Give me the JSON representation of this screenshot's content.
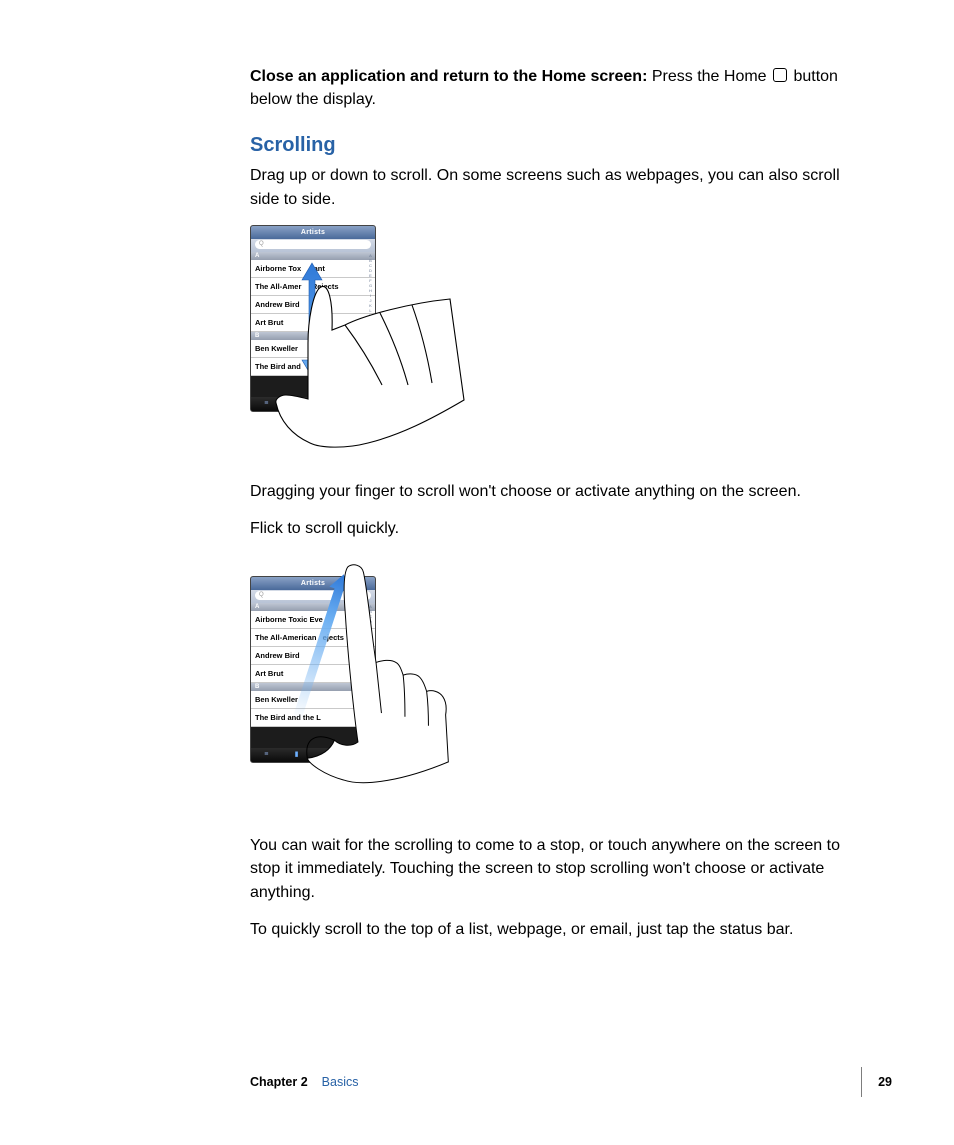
{
  "top": {
    "boldLead": "Close an application and return to the Home screen:",
    "rest1": "  Press the Home ",
    "rest2": " button below the display."
  },
  "section": {
    "heading": "Scrolling",
    "intro": "Drag up or down to scroll. On some screens such as webpages, you can also scroll side to side."
  },
  "phone": {
    "title": "Artists",
    "search": "Q",
    "groupA": "A",
    "groupB": "B",
    "rowsA_short": [
      "Airborne Tox",
      "The All-Amer",
      "Andrew Bird",
      "Art Brut"
    ],
    "rowsA_suffix": [
      "ant",
      "Rejects",
      "",
      ""
    ],
    "rowsA_long": [
      "Airborne Toxic Eve",
      "The All-American",
      "Andrew Bird",
      "Art Brut"
    ],
    "rowsA_long_suffix": [
      "",
      "ejects",
      "",
      ""
    ],
    "rowsB_short": [
      "Ben Kweller",
      "The Bird and"
    ],
    "rowsB_long": [
      "Ben Kweller",
      "The Bird and the L"
    ],
    "alpha": "A B C D E F G H I J K L M N O P Q R S T U V W X Y Z #"
  },
  "mid": {
    "p1": "Dragging your finger to scroll won't choose or activate anything on the screen.",
    "p2": "Flick to scroll quickly."
  },
  "bottom": {
    "p1": "You can wait for the scrolling to come to a stop, or touch anywhere on the screen to stop it immediately. Touching the screen to stop scrolling won't choose or activate anything.",
    "p2": "To quickly scroll to the top of a list, webpage, or email, just tap the status bar."
  },
  "footer": {
    "chapter": "Chapter 2",
    "title": "Basics",
    "page": "29"
  }
}
